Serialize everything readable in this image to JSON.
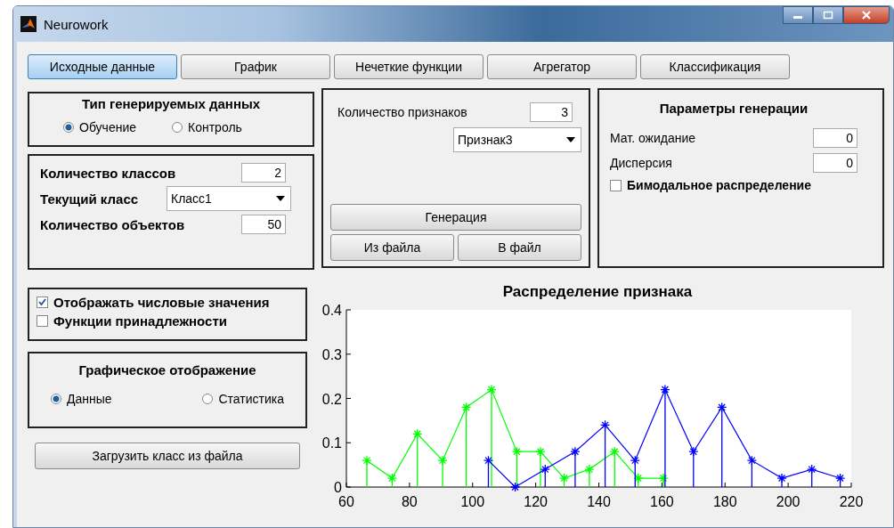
{
  "window": {
    "title": "Neurowork"
  },
  "tabs": [
    {
      "label": "Исходные данные",
      "selected": true
    },
    {
      "label": "График",
      "selected": false
    },
    {
      "label": "Нечеткие функции",
      "selected": false
    },
    {
      "label": "Агрегатор",
      "selected": false
    },
    {
      "label": "Классификация",
      "selected": false
    }
  ],
  "data_type_panel": {
    "title": "Тип генерируемых данных",
    "options": [
      {
        "label": "Обучение",
        "selected": true
      },
      {
        "label": "Контроль",
        "selected": false
      }
    ]
  },
  "class_panel": {
    "class_count": {
      "label": "Количество классов",
      "value": "2"
    },
    "current_class": {
      "label": "Текущий класс",
      "value": "Класс1"
    },
    "object_count": {
      "label": "Количество объектов",
      "value": "50"
    }
  },
  "feature_panel": {
    "feature_count": {
      "label": "Количество признаков",
      "value": "3"
    },
    "feature_select": {
      "value": "Признак3"
    },
    "buttons": [
      "Генерация",
      "Из файла",
      "В файл"
    ]
  },
  "generation_params": {
    "title": "Параметры генерации",
    "fields": [
      {
        "label": "Мат. ожидание",
        "value": "0"
      },
      {
        "label": "Дисперсия",
        "value": "0"
      }
    ],
    "bimodal": {
      "label": "Бимодальное распределение",
      "checked": false
    }
  },
  "display_options": [
    {
      "label": "Отображать числовые значения",
      "checked": true
    },
    {
      "label": "Функции принадлежности",
      "checked": false
    }
  ],
  "graphic_display": {
    "title": "Графическое отображение",
    "options": [
      {
        "label": "Данные",
        "selected": true
      },
      {
        "label": "Статистика",
        "selected": false
      }
    ]
  },
  "load_button": "Загрузить класс из файла",
  "chart": {
    "chart_data": {
      "type": "line",
      "title": "Распределение признака",
      "xlim": [
        60,
        220
      ],
      "ylim": [
        0,
        0.4
      ],
      "xticks": [
        60,
        80,
        100,
        120,
        140,
        160,
        180,
        200,
        220
      ],
      "yticks": [
        0,
        0.1,
        0.2,
        0.3,
        0.4
      ],
      "series": [
        {
          "color": "#00ff00",
          "marker": "cross",
          "x": [
            66.5,
            74.5,
            82.5,
            90.5,
            98,
            106,
            114,
            121.5,
            129,
            137,
            145,
            152.5,
            160.5
          ],
          "values": [
            0.06,
            0.02,
            0.12,
            0.06,
            0.18,
            0.22,
            0.08,
            0.08,
            0.02,
            0.04,
            0.08,
            0.02,
            0.02
          ]
        },
        {
          "color": "#0000ff",
          "marker": "cross",
          "x": [
            105,
            113.5,
            123,
            132.5,
            142,
            151.5,
            161,
            170,
            179,
            188.5,
            198,
            207.5,
            216.5
          ],
          "values": [
            0.06,
            0,
            0.04,
            0.08,
            0.14,
            0.06,
            0.22,
            0.08,
            0.18,
            0.06,
            0.02,
            0.04,
            0.02
          ]
        }
      ]
    }
  }
}
